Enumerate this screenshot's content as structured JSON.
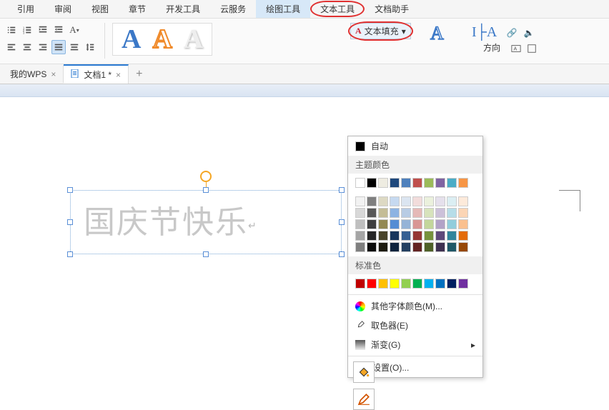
{
  "menubar": {
    "items": [
      "引用",
      "审阅",
      "视图",
      "章节",
      "开发工具",
      "云服务",
      "绘图工具",
      "文本工具",
      "文档助手"
    ],
    "active_index": 6,
    "circled_index": 7
  },
  "toolbar": {
    "text_fill_label": "文本填充",
    "direction_label": "方向"
  },
  "tabs": {
    "items": [
      {
        "label": "我的WPS",
        "active": false,
        "icon": false
      },
      {
        "label": "文档1 *",
        "active": true,
        "icon": true
      }
    ]
  },
  "textbox": {
    "content": "国庆节快乐"
  },
  "panel": {
    "auto_label": "自动",
    "theme_label": "主题颜色",
    "standard_label": "标准色",
    "more_colors_label": "其他字体颜色(M)...",
    "picker_label": "取色器(E)",
    "gradient_label": "渐变(G)",
    "more_settings_label": "更多设置(O)...",
    "theme_row1": [
      "#ffffff",
      "#000000",
      "#eeece1",
      "#1f497d",
      "#4f81bd",
      "#c0504d",
      "#9bbb59",
      "#8064a2",
      "#4bacc6",
      "#f79646"
    ],
    "theme_shades": [
      [
        "#f2f2f2",
        "#7f7f7f",
        "#ddd9c3",
        "#c6d9f0",
        "#dbe5f1",
        "#f2dcdb",
        "#ebf1dd",
        "#e5e0ec",
        "#dbeef3",
        "#fdeada"
      ],
      [
        "#d8d8d8",
        "#595959",
        "#c4bd97",
        "#8db3e2",
        "#b8cce4",
        "#e5b9b7",
        "#d7e3bc",
        "#ccc1d9",
        "#b7dde8",
        "#fbd5b5"
      ],
      [
        "#bfbfbf",
        "#3f3f3f",
        "#938953",
        "#548dd4",
        "#95b3d7",
        "#d99694",
        "#c3d69b",
        "#b2a2c7",
        "#92cddc",
        "#fac08f"
      ],
      [
        "#a5a5a5",
        "#262626",
        "#494429",
        "#17365d",
        "#366092",
        "#953734",
        "#76923c",
        "#5f497a",
        "#31859b",
        "#e36c09"
      ],
      [
        "#7f7f7f",
        "#0c0c0c",
        "#1d1b10",
        "#0f243e",
        "#244061",
        "#632423",
        "#4f6128",
        "#3f3151",
        "#205867",
        "#974806"
      ]
    ],
    "standard_colors": [
      "#c00000",
      "#ff0000",
      "#ffc000",
      "#ffff00",
      "#92d050",
      "#00b050",
      "#00b0f0",
      "#0070c0",
      "#002060",
      "#7030a0"
    ]
  }
}
